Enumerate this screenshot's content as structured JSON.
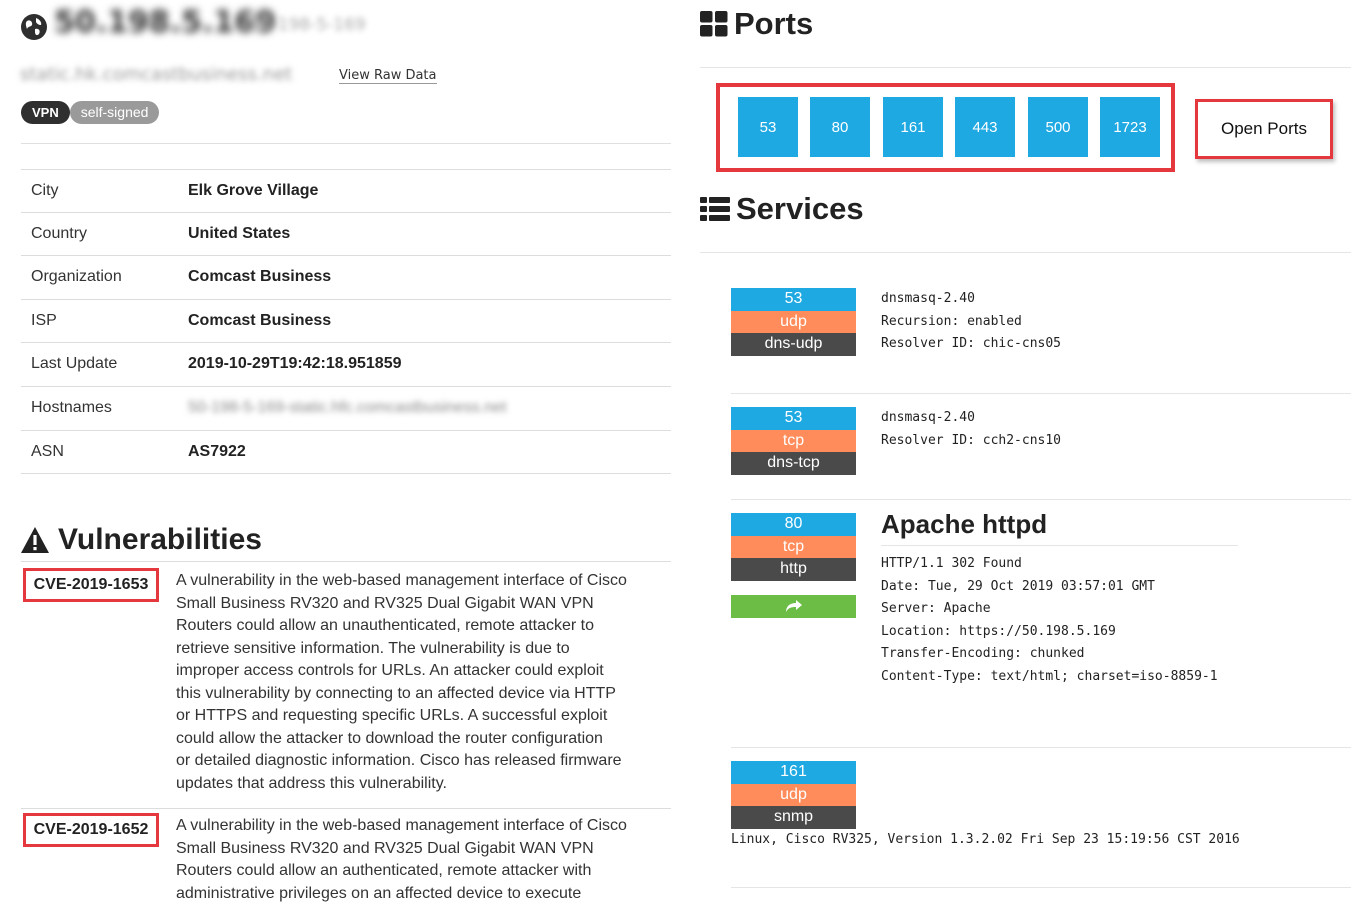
{
  "host": {
    "ip": "50.198.5.169",
    "ip_alt": "50-198-5-169",
    "hostname": "static.hk.comcastbusiness.net",
    "view_raw_label": "View Raw Data",
    "tags": [
      "VPN",
      "self-signed"
    ]
  },
  "info": [
    {
      "key": "City",
      "value": "Elk Grove Village"
    },
    {
      "key": "Country",
      "value": "United States"
    },
    {
      "key": "Organization",
      "value": "Comcast Business"
    },
    {
      "key": "ISP",
      "value": "Comcast Business"
    },
    {
      "key": "Last Update",
      "value": "2019-10-29T19:42:18.951859"
    },
    {
      "key": "Hostnames",
      "value": "50-198-5-169-static.hfc.comcastbusiness.net"
    },
    {
      "key": "ASN",
      "value": "AS7922"
    }
  ],
  "vulnerabilities": {
    "title": "Vulnerabilities",
    "items": [
      {
        "id": "CVE-2019-1653",
        "lines": [
          "A vulnerability in the web-based management interface of Cisco",
          "Small Business RV320 and RV325 Dual Gigabit WAN VPN",
          "Routers could allow an unauthenticated, remote attacker to",
          "retrieve sensitive information. The vulnerability is due to",
          "improper access controls for URLs. An attacker could exploit",
          "this vulnerability by connecting to an affected device via HTTP",
          "or HTTPS and requesting specific URLs. A successful exploit",
          "could allow the attacker to download the router configuration",
          "or detailed diagnostic information. Cisco has released firmware",
          "updates that address this vulnerability."
        ]
      },
      {
        "id": "CVE-2019-1652",
        "lines": [
          "A vulnerability in the web-based management interface of Cisco",
          "Small Business RV320 and RV325 Dual Gigabit WAN VPN",
          "Routers could allow an authenticated, remote attacker with",
          "administrative privileges on an affected device to execute"
        ]
      }
    ]
  },
  "ports": {
    "title": "Ports",
    "list": [
      "53",
      "80",
      "161",
      "443",
      "500",
      "1723"
    ],
    "callout": "Open Ports"
  },
  "services": {
    "title": "Services",
    "items": [
      {
        "port": "53",
        "proto": "udp",
        "name": "dns-udp",
        "banner": "dnsmasq-2.40\nRecursion: enabled\nResolver ID: chic-cns05"
      },
      {
        "port": "53",
        "proto": "tcp",
        "name": "dns-tcp",
        "banner": "dnsmasq-2.40\nResolver ID: cch2-cns10"
      },
      {
        "port": "80",
        "proto": "tcp",
        "name": "http",
        "title": "Apache httpd",
        "banner": "HTTP/1.1 302 Found\nDate: Tue, 29 Oct 2019 03:57:01 GMT\nServer: Apache\nLocation: https://50.198.5.169\nTransfer-Encoding: chunked\nContent-Type: text/html; charset=iso-8859-1"
      },
      {
        "port": "161",
        "proto": "udp",
        "name": "snmp",
        "banner": "Linux, Cisco RV325, Version 1.3.2.02 Fri Sep 23 15:19:56 CST 2016"
      }
    ]
  },
  "colors": {
    "port_blue": "#1fa9e2",
    "proto_orange": "#ff8c5a",
    "name_dark": "#4a4a4a",
    "link_green": "#6bbd45",
    "highlight_red": "#e5373e"
  }
}
